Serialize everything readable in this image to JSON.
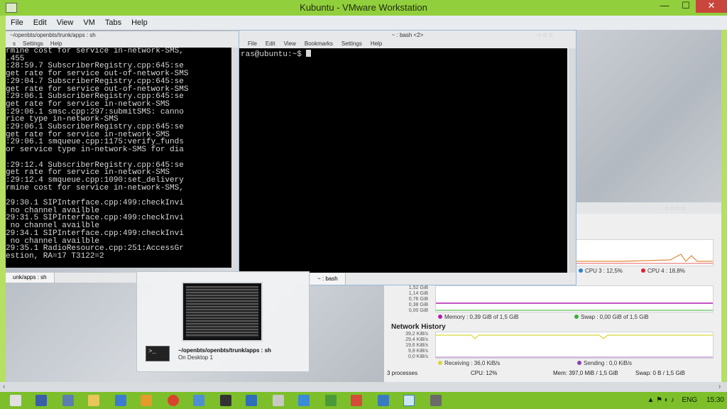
{
  "vmware": {
    "title": "Kubuntu - VMware Workstation",
    "menu": [
      "File",
      "Edit",
      "View",
      "VM",
      "Tabs",
      "Help"
    ],
    "controls": {
      "minimize": "—",
      "maximize": "☐",
      "close": "✕"
    }
  },
  "terminal_left": {
    "title": "~/openbts/openbts/trunk/apps : sh",
    "menu": [
      "s",
      "Settings",
      "Help"
    ],
    "lines": [
      "rmine cost for service in-network-SMS,",
      ".455",
      ":28:59.7 SubscriberRegistry.cpp:645:se",
      "get rate for service out-of-network-SMS",
      ":29:04.7 SubscriberRegistry.cpp:645:se",
      "get rate for service out-of-network-SMS",
      ":29:06.1 SubscriberRegistry.cpp:645:se",
      "get rate for service in-network-SMS",
      ":29:06.1 smsc.cpp:297:submitSMS: canno",
      "rice type in-network-SMS",
      ":29:06.1 SubscriberRegistry.cpp:645:se",
      "get rate for service in-network-SMS",
      ":29:06.1 smqueue.cpp:1175:verify_funds",
      "or service type in-network-SMS for dia",
      "",
      ":29:12.4 SubscriberRegistry.cpp:645:se",
      "get rate for service in-network-SMS",
      ":29:12.4 smqueue.cpp:1090:set_delivery",
      "rmine cost for service in-network-SMS,",
      "",
      "29:30.1 SIPInterface.cpp:499:checkInvi",
      " no channel availble",
      "29:31.5 SIPInterface.cpp:499:checkInvi",
      " no channel availble",
      "29:34.1 SIPInterface.cpp:499:checkInvi",
      " no channel availble",
      "29:35.1 RadioResource.cpp:251:AccessGr",
      "estion, RA=17 T3122=2"
    ],
    "tab": "unk/apps : sh"
  },
  "terminal_right": {
    "title": "~ : bash <2>",
    "menu": [
      "File",
      "Edit",
      "View",
      "Bookmarks",
      "Settings",
      "Help"
    ],
    "prompt": "ras@ubuntu:~$ ",
    "tab": "~ : bash"
  },
  "sysmon": {
    "cpu3": "CPU 3 : 12,5%",
    "cpu4": "CPU 4 : 18,8%",
    "mem_ticks": [
      "1,52 GiB",
      "1,14 GiB",
      "0,76 GiB",
      "0,38 GiB",
      "0,00 GiB"
    ],
    "memory": "Memory : 0,39 GiB of 1,5 GiB",
    "swap": "Swap : 0,00 GiB of 1,5 GiB",
    "network_title": "Network History",
    "net_ticks": [
      "39,2 KiB/s",
      "29,4 KiB/s",
      "19,6 KiB/s",
      "9,8 KiB/s",
      "0,0 KiB/s"
    ],
    "receiving": "Receiving : 36,0 KiB/s",
    "sending": "Sending : 0,0 KiB/s",
    "status_processes": "3 processes",
    "status_cpu": "CPU: 12%",
    "status_mem": "Mem: 397,0 MiB / 1,5 GiB",
    "status_swap": "Swap: 0 B / 1,5 GiB"
  },
  "switcher": {
    "path": "~/openbts/openbts/trunk/apps : sh",
    "desktop": "On Desktop 1",
    "icon_text": ">_"
  },
  "taskbar": {
    "language": "ENG",
    "time": "15:30"
  },
  "colors": {
    "cpu3": "#2f7fd8",
    "cpu4": "#e0242a",
    "memory": "#b01fb0",
    "swap": "#36b032",
    "receiving": "#d8d63a",
    "sending": "#8a43b3",
    "taskbar": "#7cbf2a"
  }
}
